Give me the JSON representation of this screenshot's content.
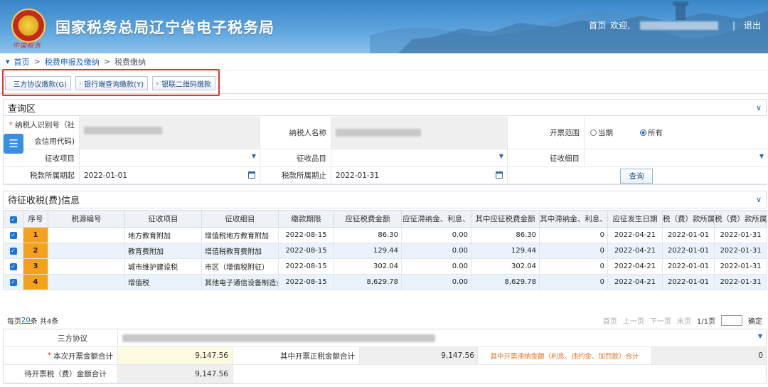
{
  "header": {
    "title": "国家税务总局辽宁省电子税务局",
    "emblem_text": "中国税务",
    "home": "首页",
    "welcome": "欢迎,",
    "sep": "|",
    "logout": "退出"
  },
  "breadcrumb": {
    "home": "首页",
    "sep1": ">",
    "level1": "税费申报及缴纳",
    "sep2": ">",
    "level2": "税费缴纳"
  },
  "toolbar": {
    "btn1": "三方协议缴款(G)",
    "btn2": "银行端查询缴款(Y)",
    "btn3": "银联二维码缴款"
  },
  "query": {
    "title": "查询区",
    "taxpayer_id_label_1": "纳税人识别号（社",
    "taxpayer_id_label_2": "会信用代码)",
    "taxpayer_name_label": "纳税人名称",
    "invoice_scope_label": "开票范围",
    "scope_current": "当期",
    "scope_all": "所有",
    "levy_item_label": "征收项目",
    "levy_product_label": "征收品目",
    "levy_subitem_label": "征收细目",
    "period_start_label": "税款所属期起",
    "period_start_value": "2022-01-01",
    "period_end_label": "税款所属期止",
    "period_end_value": "2022-01-31",
    "query_button": "查询"
  },
  "pending": {
    "title": "待征收税(费)信息",
    "columns": [
      "序号",
      "税源编号",
      "征收项目",
      "征收细目",
      "缴款期限",
      "应征税费金额",
      "应征滞纳金、利息、",
      "其中应征税费金额",
      "其中滞纳金、利息、",
      "应征发生日期",
      "税（费）款所属",
      "税（费）款所属"
    ],
    "rows": [
      {
        "seq": "1",
        "source": "",
        "item": "地方教育附加",
        "subitem": "增值税地方教育附加",
        "deadline": "2022-08-15",
        "amount": "86.30",
        "late": "0.00",
        "sub_amount": "86.30",
        "sub_late": "0",
        "date": "2022-04-21",
        "start": "2022-01-01",
        "end": "2022-01-31"
      },
      {
        "seq": "2",
        "source": "",
        "item": "教育费附加",
        "subitem": "增值税教育费附加",
        "deadline": "2022-08-15",
        "amount": "129.44",
        "late": "0.00",
        "sub_amount": "129.44",
        "sub_late": "0",
        "date": "2022-04-21",
        "start": "2022-01-01",
        "end": "2022-01-31"
      },
      {
        "seq": "3",
        "source": "",
        "item": "城市维护建设税",
        "subitem": "市区（增值税附征）",
        "deadline": "2022-08-15",
        "amount": "302.04",
        "late": "0.00",
        "sub_amount": "302.04",
        "sub_late": "0",
        "date": "2022-04-21",
        "start": "2022-01-01",
        "end": "2022-01-31"
      },
      {
        "seq": "4",
        "source": "",
        "item": "增值税",
        "subitem": "其他电子通信设备制造业",
        "deadline": "2022-08-15",
        "amount": "8,629.78",
        "late": "0.00",
        "sub_amount": "8,629.78",
        "sub_late": "0",
        "date": "2022-04-21",
        "start": "2022-01-01",
        "end": "2022-01-31"
      }
    ],
    "pager_prefix": "每页",
    "pager_size": "20",
    "pager_suffix": "条 共4条",
    "first": "首页",
    "prev": "上一页",
    "next": "下一页",
    "last": "末页",
    "pages": "1/1页",
    "confirm": "确定"
  },
  "bottom": {
    "agreement_label": "三方协议",
    "invoice_total_label": "本次开票金额合计",
    "invoice_total_value": "9,147.56",
    "normal_total_label": "其中开票正税金额合计",
    "normal_total_value": "9,147.56",
    "late_total_label": "其中开票滞纳金额（利息、违约金、加罚款）合计",
    "late_total_value": "0",
    "pending_invoice_label": "待开票税（费）金额合计",
    "pending_invoice_value": "9,147.56"
  }
}
